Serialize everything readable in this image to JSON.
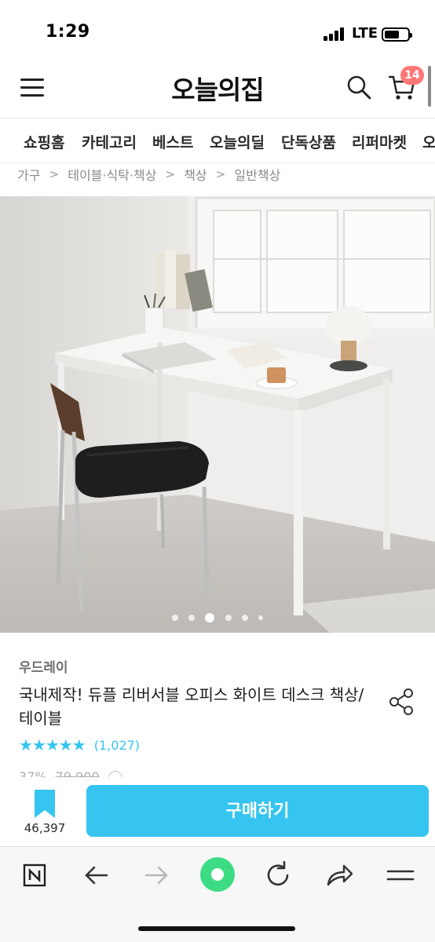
{
  "status_bar": {
    "time": "1:29",
    "network": "LTE"
  },
  "header": {
    "logo": "오늘의집",
    "cart_count": "14",
    "icons": [
      "menu-icon",
      "search-icon",
      "cart-icon"
    ]
  },
  "category_tabs": [
    {
      "label": "쇼핑홈"
    },
    {
      "label": "카테고리"
    },
    {
      "label": "베스트"
    },
    {
      "label": "오늘의딜"
    },
    {
      "label": "단독상품"
    },
    {
      "label": "리퍼마켓"
    },
    {
      "label": "오"
    }
  ],
  "breadcrumb": [
    {
      "label": "가구"
    },
    {
      "label": "테이블·식탁·책상"
    },
    {
      "label": "책상"
    },
    {
      "label": "일반책상"
    }
  ],
  "image_carousel": {
    "total": 6,
    "active_index": 2
  },
  "product": {
    "brand": "우드레이",
    "title": "국내제작! 듀플 리버서블 오피스 화이트 데스크 책상/테이블",
    "rating": 5,
    "review_count": "(1,027)",
    "discount": "37%",
    "original_price": "79,900"
  },
  "purchase_bar": {
    "bookmark_count": "46,397",
    "buy_label": "구매하기"
  },
  "browser_toolbar": {
    "icons": [
      "naver-n-icon",
      "back-arrow-icon",
      "forward-arrow-icon",
      "green-dot-icon",
      "refresh-icon",
      "share-arrow-icon",
      "menu-lines-icon"
    ]
  },
  "colors": {
    "accent": "#35c5f0",
    "badge": "#ff7777",
    "green": "#3ddc84"
  }
}
